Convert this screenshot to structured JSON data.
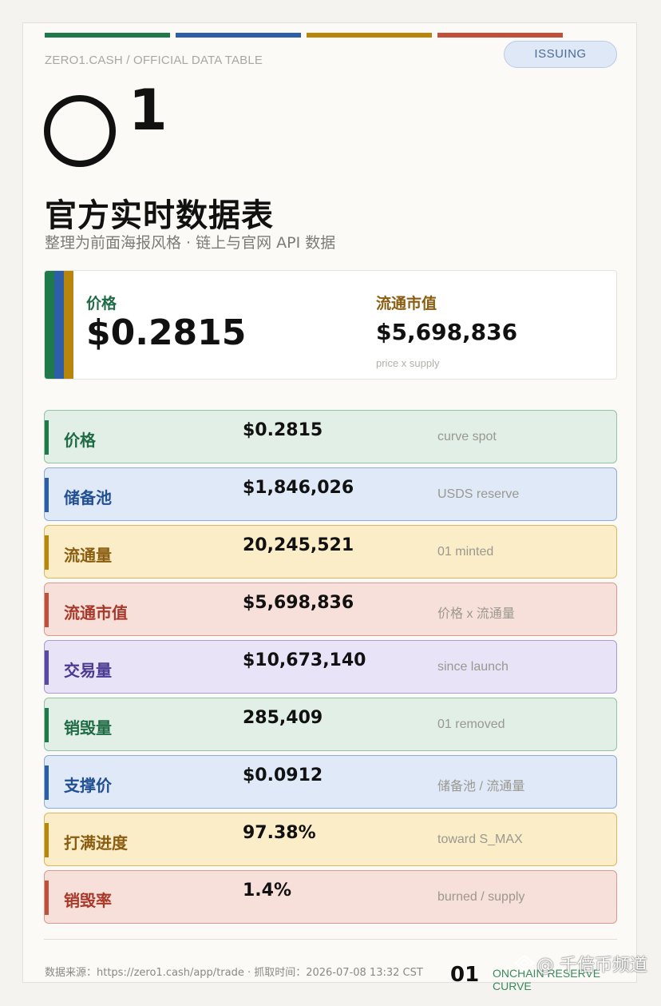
{
  "brand": {
    "line": "ZERO1.CASH / OFFICIAL DATA TABLE",
    "status_badge": "ISSUING",
    "logo_number": "1",
    "stripe_colors": [
      "#1f7a4b",
      "#2c5fa8",
      "#b8860b",
      "#c0503a"
    ]
  },
  "header": {
    "title": "官方实时数据表",
    "subtitle": "整理为前面海报风格 · 链上与官网 API 数据"
  },
  "hero": {
    "price_label": "价格",
    "price_value": "$0.2815",
    "cap_label": "流通市值",
    "cap_value": "$5,698,836",
    "cap_note": "price x supply"
  },
  "rows": [
    {
      "label": "价格",
      "value": "$0.2815",
      "note": "curve spot",
      "theme": "green"
    },
    {
      "label": "储备池",
      "value": "$1,846,026",
      "note": "USDS reserve",
      "theme": "blue"
    },
    {
      "label": "流通量",
      "value": "20,245,521",
      "note": "01 minted",
      "theme": "gold"
    },
    {
      "label": "流通市值",
      "value": "$5,698,836",
      "note": "价格 x 流通量",
      "theme": "red"
    },
    {
      "label": "交易量",
      "value": "$10,673,140",
      "note": "since launch",
      "theme": "purple"
    },
    {
      "label": "销毁量",
      "value": "285,409",
      "note": "01 removed",
      "theme": "green"
    },
    {
      "label": "支撑价",
      "value": "$0.0912",
      "note": "储备池 / 流通量",
      "theme": "blue"
    },
    {
      "label": "打满进度",
      "value": "97.38%",
      "note": "toward S_MAX",
      "theme": "gold"
    },
    {
      "label": "销毁率",
      "value": "1.4%",
      "note": "burned / supply",
      "theme": "red"
    }
  ],
  "themes": {
    "green": {
      "bg": "#e1efe6",
      "border": "#8fc4a4",
      "accent": "#1f7a4b",
      "text": "#1f6b45"
    },
    "blue": {
      "bg": "#dfe9f8",
      "border": "#8eacd9",
      "accent": "#2c5fa8",
      "text": "#234f93"
    },
    "gold": {
      "bg": "#faedc8",
      "border": "#d9b85e",
      "accent": "#b8860b",
      "text": "#8a5d10"
    },
    "red": {
      "bg": "#f8e0da",
      "border": "#dc9a8c",
      "accent": "#c0503a",
      "text": "#a8392a"
    },
    "purple": {
      "bg": "#e8e3f7",
      "border": "#a99bd8",
      "accent": "#5b48a6",
      "text": "#4a3a93"
    }
  },
  "footer": {
    "source": "数据来源：https://zero1.cash/app/trade  ·  抓取时间：2026-07-08 13:32 CST",
    "page_number": "01",
    "curve_label": "ONCHAIN RESERVE CURVE",
    "watermark": "@ 千倍币频道"
  }
}
